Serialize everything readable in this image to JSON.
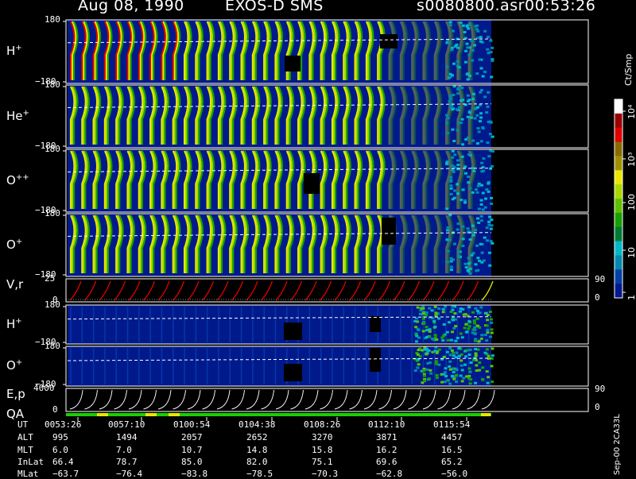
{
  "header": {
    "date": "Aug 08, 1990",
    "mission": "EXOS-D SMS",
    "file": "s0080800.asr",
    "time": "00:53:26"
  },
  "colorbar": {
    "unit_label": "Ct/Smp",
    "ticks": [
      "10⁴",
      "10³",
      "100",
      "10",
      "1"
    ],
    "colors": [
      "#ffffff",
      "#9b0000",
      "#e00000",
      "#8a6a00",
      "#a09000",
      "#e8e800",
      "#a8d800",
      "#60c000",
      "#18a000",
      "#007a30",
      "#00b8c8",
      "#008ab0",
      "#0040a8",
      "#001890"
    ]
  },
  "panels": [
    {
      "id": "h-plus-1",
      "label": "H",
      "sup": "+",
      "ytop": "180",
      "ybot": "−180"
    },
    {
      "id": "he-plus",
      "label": "He",
      "sup": "+",
      "ytop": "180",
      "ybot": "−180"
    },
    {
      "id": "o-pp",
      "label": "O",
      "sup": "++",
      "ytop": "180",
      "ybot": "−180"
    },
    {
      "id": "o-plus-1",
      "label": "O",
      "sup": "+",
      "ytop": "180",
      "ybot": "−180"
    },
    {
      "id": "vr",
      "label": "V,r",
      "sup": "",
      "ytop": "25",
      "ybot": "0",
      "rtop": "90",
      "rbot": "0"
    },
    {
      "id": "h-plus-2",
      "label": "H",
      "sup": "+",
      "ytop": "180",
      "ybot": "−180"
    },
    {
      "id": "o-plus-2",
      "label": "O",
      "sup": "+",
      "ytop": "180",
      "ybot": "−180"
    },
    {
      "id": "ep",
      "label": "E,p",
      "sup": "",
      "ytop": "4000",
      "ybot": "0",
      "rtop": "90",
      "rbot": "0",
      "qa": "QA"
    }
  ],
  "footer": {
    "row_labels": [
      "UT",
      "ALT",
      "MLT",
      "InLat",
      "MLat"
    ],
    "columns": [
      {
        "UT": "0053:26",
        "ALT": "995",
        "MLT": "6.0",
        "InLat": "66.4",
        "MLat": "−63.7"
      },
      {
        "UT": "0057:10",
        "ALT": "1494",
        "MLT": "7.0",
        "InLat": "78.7",
        "MLat": "−76.4"
      },
      {
        "UT": "0100:54",
        "ALT": "2057",
        "MLT": "10.7",
        "InLat": "85.0",
        "MLat": "−83.8"
      },
      {
        "UT": "0104:38",
        "ALT": "2652",
        "MLT": "14.8",
        "InLat": "82.0",
        "MLat": "−78.5"
      },
      {
        "UT": "0108:26",
        "ALT": "3270",
        "MLT": "15.8",
        "InLat": "75.1",
        "MLat": "−70.3"
      },
      {
        "UT": "0112:10",
        "ALT": "3871",
        "MLT": "16.2",
        "InLat": "69.6",
        "MLat": "−62.8"
      },
      {
        "UT": "0115:54",
        "ALT": "4457",
        "MLT": "16.5",
        "InLat": "65.2",
        "MLat": "−56.0"
      }
    ],
    "vertical_note": "Sep-00 2CA33L"
  },
  "chart_data": {
    "type": "heatmap",
    "title": "Aug 08, 1990   EXOS-D SMS",
    "x_ticks_ut": [
      "0053:26",
      "0057:10",
      "0100:54",
      "0104:38",
      "0108:26",
      "0112:10",
      "0115:54"
    ],
    "colorbar_unit": "Ct/Smp",
    "colorbar_ticks": [
      "1",
      "10",
      "100",
      "10³",
      "10⁴"
    ],
    "series": [
      {
        "name": "H+",
        "ylim": [
          -180,
          180
        ]
      },
      {
        "name": "He+",
        "ylim": [
          -180,
          180
        ]
      },
      {
        "name": "O++",
        "ylim": [
          -180,
          180
        ]
      },
      {
        "name": "O+",
        "ylim": [
          -180,
          180
        ]
      },
      {
        "name": "V,r",
        "ylim": [
          0,
          25
        ]
      },
      {
        "name": "H+",
        "ylim": [
          -180,
          180
        ]
      },
      {
        "name": "O+",
        "ylim": [
          -180,
          180
        ]
      },
      {
        "name": "E,p",
        "ylim": [
          0,
          4000
        ]
      }
    ]
  }
}
